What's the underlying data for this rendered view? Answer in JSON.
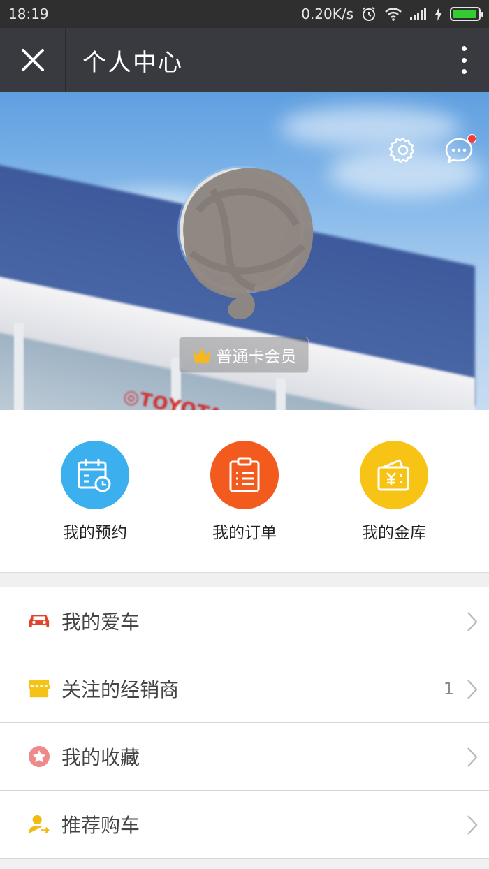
{
  "status_bar": {
    "time": "18:19",
    "network_speed": "0.20K/s",
    "icons": [
      "alarm-icon",
      "wifi-icon",
      "signal-icon",
      "charging-icon",
      "battery-icon"
    ],
    "battery_level": 0.95
  },
  "title_bar": {
    "title": "个人中心",
    "close_icon": "close-icon",
    "more_icon": "more-vertical-icon"
  },
  "hero": {
    "settings_icon": "gear-icon",
    "messages_icon": "chat-bubble-icon",
    "has_unread": true,
    "member_level": "普通卡会员",
    "badge_icon": "crown-icon"
  },
  "quick_actions": [
    {
      "label": "我的预约",
      "icon": "calendar-clock-icon",
      "color": "#3cb0ef"
    },
    {
      "label": "我的订单",
      "icon": "clipboard-list-icon",
      "color": "#f25a1e"
    },
    {
      "label": "我的金库",
      "icon": "wallet-yen-icon",
      "color": "#f7c315"
    }
  ],
  "menu": [
    {
      "label": "我的爱车",
      "icon": "car-icon",
      "color": "#e0452b",
      "count": ""
    },
    {
      "label": "关注的经销商",
      "icon": "store-icon",
      "color": "#f3c417",
      "count": "1"
    },
    {
      "label": "我的收藏",
      "icon": "star-circle-icon",
      "color": "#ef8a8a",
      "count": ""
    },
    {
      "label": "推荐购车",
      "icon": "user-share-icon",
      "color": "#f0bb16",
      "count": ""
    }
  ]
}
